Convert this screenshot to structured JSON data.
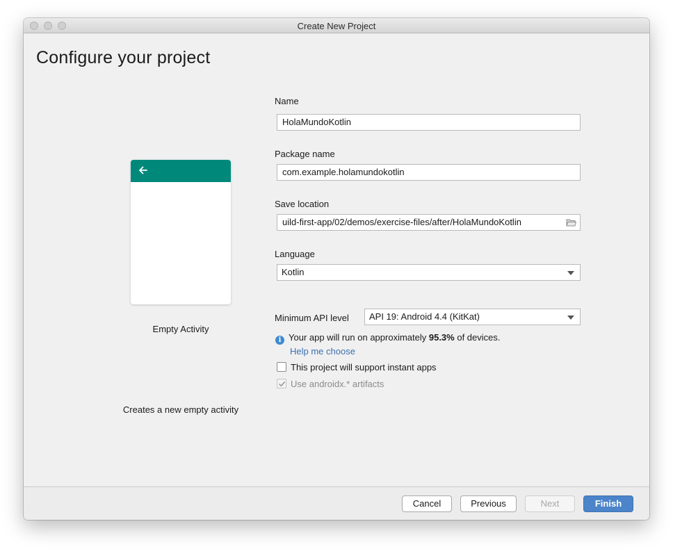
{
  "window": {
    "title": "Create New Project"
  },
  "page": {
    "title": "Configure your project"
  },
  "template": {
    "name": "Empty Activity",
    "description": "Creates a new empty activity",
    "accent_color": "#00897b",
    "back_icon": "arrow-left-icon"
  },
  "form": {
    "name_label": "Name",
    "name_value": "HolaMundoKotlin",
    "package_label": "Package name",
    "package_value": "com.example.holamundokotlin",
    "location_label": "Save location",
    "location_value": "uild-first-app/02/demos/exercise-files/after/HolaMundoKotlin",
    "location_icon": "folder-icon",
    "language_label": "Language",
    "language_value": "Kotlin",
    "api_label": "Minimum API level",
    "api_value": "API 19: Android 4.4 (KitKat)",
    "info_prefix": "Your app will run on approximately ",
    "info_percent": "95.3%",
    "info_suffix": " of devices.",
    "help_link": "Help me choose",
    "instant_apps_label": "This project will support instant apps",
    "instant_apps_checked": false,
    "androidx_label": "Use androidx.* artifacts",
    "androidx_checked": true,
    "androidx_enabled": false
  },
  "buttons": {
    "cancel": "Cancel",
    "previous": "Previous",
    "next": "Next",
    "finish": "Finish",
    "next_enabled": false,
    "finish_color": "#4c84c9"
  }
}
